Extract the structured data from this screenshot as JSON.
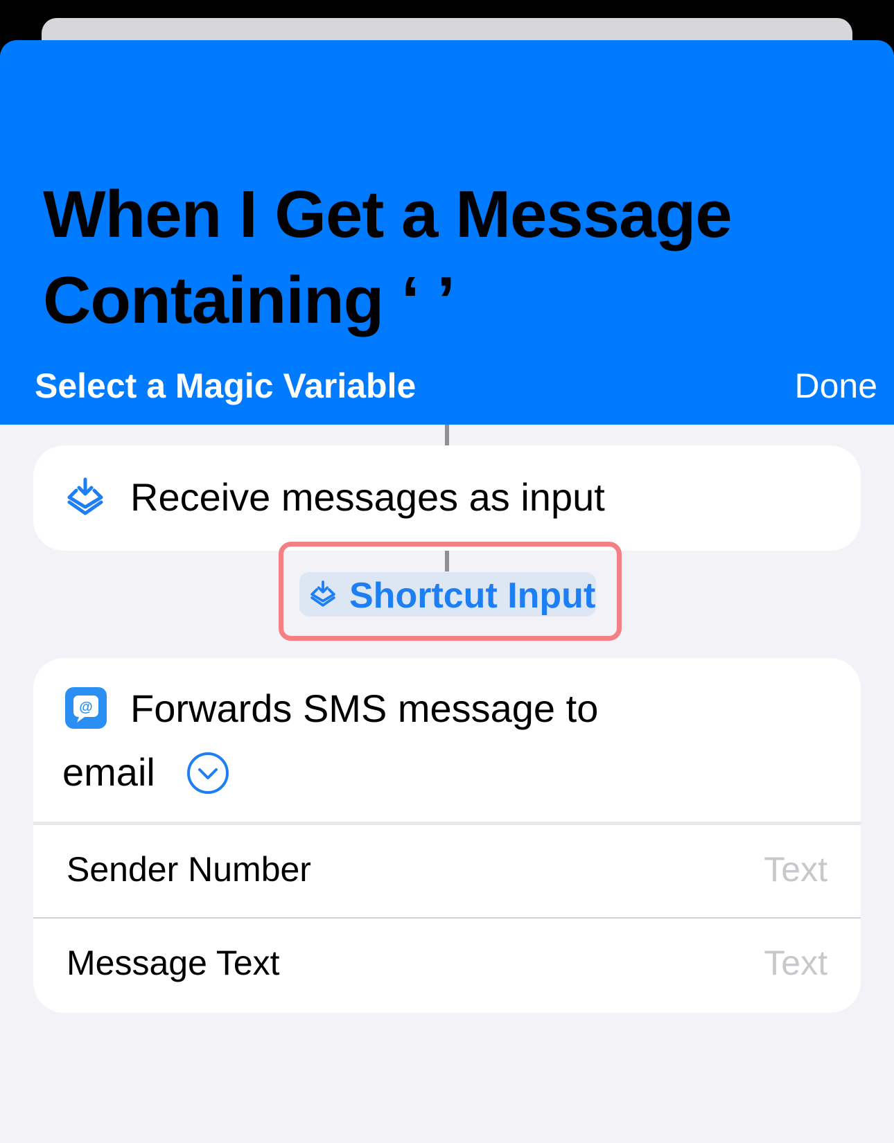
{
  "header": {
    "title": "When I Get a Message Containing ‘ ’",
    "subtitle": "Select a Magic Variable",
    "done_label": "Done",
    "color": "#007aff"
  },
  "receive_action": {
    "label": "Receive messages as input",
    "icon": "shortcut-input-icon"
  },
  "magic_variable": {
    "label": "Shortcut Input",
    "icon": "shortcut-input-icon",
    "highlight_color": "#f47f84"
  },
  "forward_action": {
    "title_line1": "Forwards SMS message to",
    "title_line2": "email",
    "app_icon": "mail-at-icon",
    "expand_icon": "chevron-down-circle-icon",
    "params": [
      {
        "label": "Sender Number",
        "placeholder": "Text"
      },
      {
        "label": "Message Text",
        "placeholder": "Text"
      }
    ]
  }
}
